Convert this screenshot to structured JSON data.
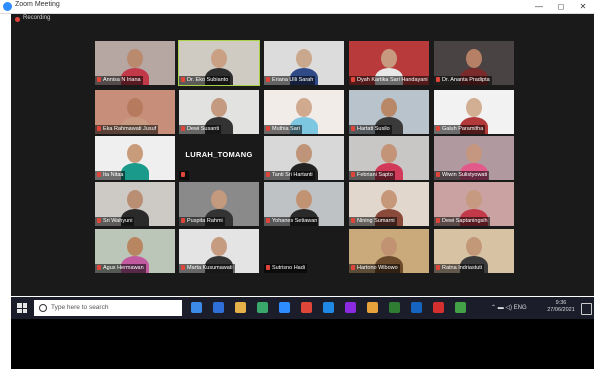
{
  "window": {
    "title": "Zoom Meeting",
    "minimize": "—",
    "maximize": "◻",
    "close": "✕"
  },
  "meeting": {
    "label": "Recording"
  },
  "participants": [
    {
      "name": "Annisa N Iriana",
      "bg": "#b6a7a2",
      "skin": "#b98a6e",
      "cloth": "#c23a4a"
    },
    {
      "name": "Dr. Eko Subianto",
      "bg": "#cfcac2",
      "skin": "#c9a083",
      "cloth": "#2d2d2d",
      "speaking": true
    },
    {
      "name": "Eriana Ulli Sarah",
      "bg": "#dcdcdc",
      "skin": "#caa88d",
      "cloth": "#2f4a86"
    },
    {
      "name": "Dyah Kartika Sari Handayani",
      "bg": "#b83a3a",
      "skin": "#c79a80",
      "cloth": "#e8e8e8"
    },
    {
      "name": "Dr. Ananta Pradipta",
      "bg": "#4a4343",
      "skin": "#b58066",
      "cloth": "#7a2a2a"
    },
    {
      "name": "Eka Rahmawati Jusuf",
      "bg": "#c78f7a",
      "skin": "#b67a5f",
      "cloth": "#c89a7f"
    },
    {
      "name": "Dewi Susanti",
      "bg": "#e2e2e0",
      "skin": "#c49a80",
      "cloth": "#333333"
    },
    {
      "name": "Muthia Sari",
      "bg": "#f1ece8",
      "skin": "#d1a98f",
      "cloth": "#7ec7e0"
    },
    {
      "name": "Hartati Susilo",
      "bg": "#b8c3cc",
      "skin": "#b98866",
      "cloth": "#3a3a3a"
    },
    {
      "name": "Galuh Paramitha",
      "bg": "#f2f2f2",
      "skin": "#d2ae93",
      "cloth": "#b23a3a"
    },
    {
      "name": "Ita Nitaa",
      "bg": "#efefef",
      "skin": "#c89b7a",
      "cloth": "#1a9a8a"
    },
    {
      "name": "LURAH_TOMANG",
      "bg": "#1a1a1a",
      "blank": true
    },
    {
      "name": "Tanti Sri Hartanti",
      "bg": "#d8d8d8",
      "skin": "#bf9478",
      "cloth": "#222222"
    },
    {
      "name": "Febriani Sapto",
      "bg": "#c9c7c5",
      "skin": "#c39477",
      "cloth": "#d23a5a"
    },
    {
      "name": "Wiwin Sulistyowati",
      "bg": "#b09aa0",
      "skin": "#c59680",
      "cloth": "#e25a8a"
    },
    {
      "name": "Sri Wahyuni",
      "bg": "#cdc9c5",
      "skin": "#b98e73",
      "cloth": "#2a2a2a"
    },
    {
      "name": "Puspita Rahmi",
      "bg": "#8a8a8a",
      "skin": "#c49a7e",
      "cloth": "#333333"
    },
    {
      "name": "Yohanes Setiawan",
      "bg": "#bfc2c4",
      "skin": "#c29373",
      "cloth": "#2a2a2a"
    },
    {
      "name": "Nining Sumarni",
      "bg": "#e1d7cc",
      "skin": "#c69879",
      "cloth": "#8a4a3a"
    },
    {
      "name": "Dewi Saptaningsih",
      "bg": "#caa2a2",
      "skin": "#c69a80",
      "cloth": "#c23a4a"
    },
    {
      "name": "Agus Hermawan",
      "bg": "#bcc6b8",
      "skin": "#b98662",
      "cloth": "#c25aa0"
    },
    {
      "name": "Marta Kusumawati",
      "bg": "#e4e4e4",
      "skin": "#c69c80",
      "cloth": "#333333"
    },
    {
      "name": "Sutrisno Hadi",
      "bg": "#1a1a1a",
      "blank": true
    },
    {
      "name": "Hartono Wibowo",
      "bg": "#caa97a",
      "skin": "#c29373",
      "cloth": "#6a4a2a"
    },
    {
      "name": "Ratna Indriastuti",
      "bg": "#d8c2a4",
      "skin": "#c39879",
      "cloth": "#3a3a3a"
    }
  ],
  "taskbar": {
    "search_placeholder": "Type here to search",
    "clock_time": "9:36",
    "clock_date": "27/06/2021",
    "tray": "⌃ ▬ ◁) ENG",
    "apps": [
      "#3c8ce7",
      "#2e6fd9",
      "#e5b24a",
      "#3aa86a",
      "#2d8cff",
      "#e0453a",
      "#1f88e5",
      "#8a2be2",
      "#e7a23c",
      "#2e7d32",
      "#1565c0",
      "#d32f2f",
      "#43a047"
    ]
  }
}
